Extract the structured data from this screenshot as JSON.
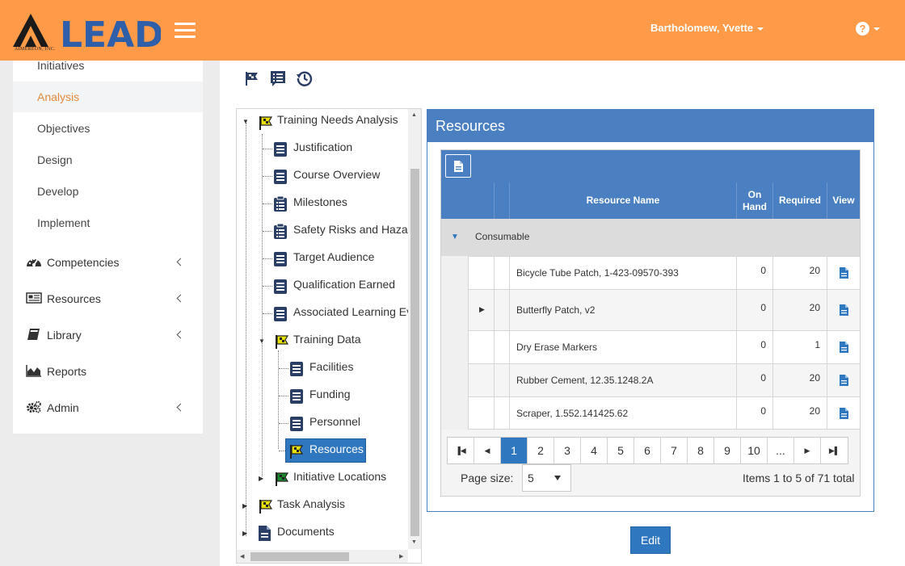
{
  "header": {
    "logo_text": "LEAD",
    "logo_subtext": "AIMEREON, INC.",
    "user_name": "Bartholomew, Yvette",
    "help_symbol": "?",
    "colors": {
      "bar": "#fe9a48",
      "logo_blue": "#2f5fa8",
      "accent": "#e58a3c"
    }
  },
  "sidebar": {
    "sub_items": [
      {
        "label": "Initiatives"
      },
      {
        "label": "Analysis",
        "active": true
      },
      {
        "label": "Objectives"
      },
      {
        "label": "Design"
      },
      {
        "label": "Develop"
      },
      {
        "label": "Implement"
      }
    ],
    "main_items": [
      {
        "label": "Competencies",
        "icon": "dashboard-icon",
        "has_chevron": true
      },
      {
        "label": "Resources",
        "icon": "newspaper-icon",
        "has_chevron": true
      },
      {
        "label": "Library",
        "icon": "book-icon",
        "has_chevron": true
      },
      {
        "label": "Reports",
        "icon": "area-chart-icon",
        "has_chevron": false
      },
      {
        "label": "Admin",
        "icon": "gears-icon",
        "has_chevron": true
      }
    ]
  },
  "toolbar_icons": [
    "flag-icon",
    "list-alt-icon",
    "history-icon"
  ],
  "tree": {
    "items": [
      {
        "label": "Training Needs Analysis",
        "icon": "yellow-flag-icon"
      },
      {
        "label": "Justification",
        "icon": "document-list-icon"
      },
      {
        "label": "Course Overview",
        "icon": "document-list-icon"
      },
      {
        "label": "Milestones",
        "icon": "clipboard-icon"
      },
      {
        "label": "Safety Risks and Haza",
        "icon": "clipboard-icon"
      },
      {
        "label": "Target Audience",
        "icon": "document-list-icon"
      },
      {
        "label": "Qualification Earned",
        "icon": "document-list-icon"
      },
      {
        "label": "Associated Learning Ev",
        "icon": "document-list-icon"
      },
      {
        "label": "Training Data",
        "icon": "yellow-flag-icon"
      },
      {
        "label": "Facilities",
        "icon": "document-list-icon"
      },
      {
        "label": "Funding",
        "icon": "document-list-icon"
      },
      {
        "label": "Personnel",
        "icon": "document-list-icon"
      },
      {
        "label": "Resources",
        "icon": "yellow-flag-icon",
        "selected": true
      },
      {
        "label": "Initiative Locations",
        "icon": "green-flag-icon"
      },
      {
        "label": "Task Analysis",
        "icon": "yellow-flag-icon"
      },
      {
        "label": "Documents",
        "icon": "file-icon"
      }
    ]
  },
  "panel": {
    "title": "Resources",
    "columns": {
      "resource_name": "Resource Name",
      "on_hand_line1": "On",
      "on_hand_line2": "Hand",
      "required": "Required",
      "view": "View"
    },
    "group_label": "Consumable",
    "rows": [
      {
        "name": "Bicycle Tube Patch, 1-423-09570-393",
        "on_hand": "0",
        "required": "20",
        "has_children": false
      },
      {
        "name": "Butterfly Patch, v2",
        "on_hand": "0",
        "required": "20",
        "has_children": true
      },
      {
        "name": "Dry Erase Markers",
        "on_hand": "0",
        "required": "1",
        "has_children": false
      },
      {
        "name": "Rubber Cement, 12.35.1248.2A",
        "on_hand": "0",
        "required": "20",
        "has_children": false
      },
      {
        "name": "Scraper, 1.552.141425.62",
        "on_hand": "0",
        "required": "20",
        "has_children": false
      }
    ],
    "pager": {
      "pages": [
        "1",
        "2",
        "3",
        "4",
        "5",
        "6",
        "7",
        "8",
        "9",
        "10",
        "..."
      ],
      "current": "1",
      "page_size_label": "Page size:",
      "page_size": "5",
      "items_info": "Items 1 to 5 of 71 total"
    },
    "edit_label": "Edit"
  }
}
